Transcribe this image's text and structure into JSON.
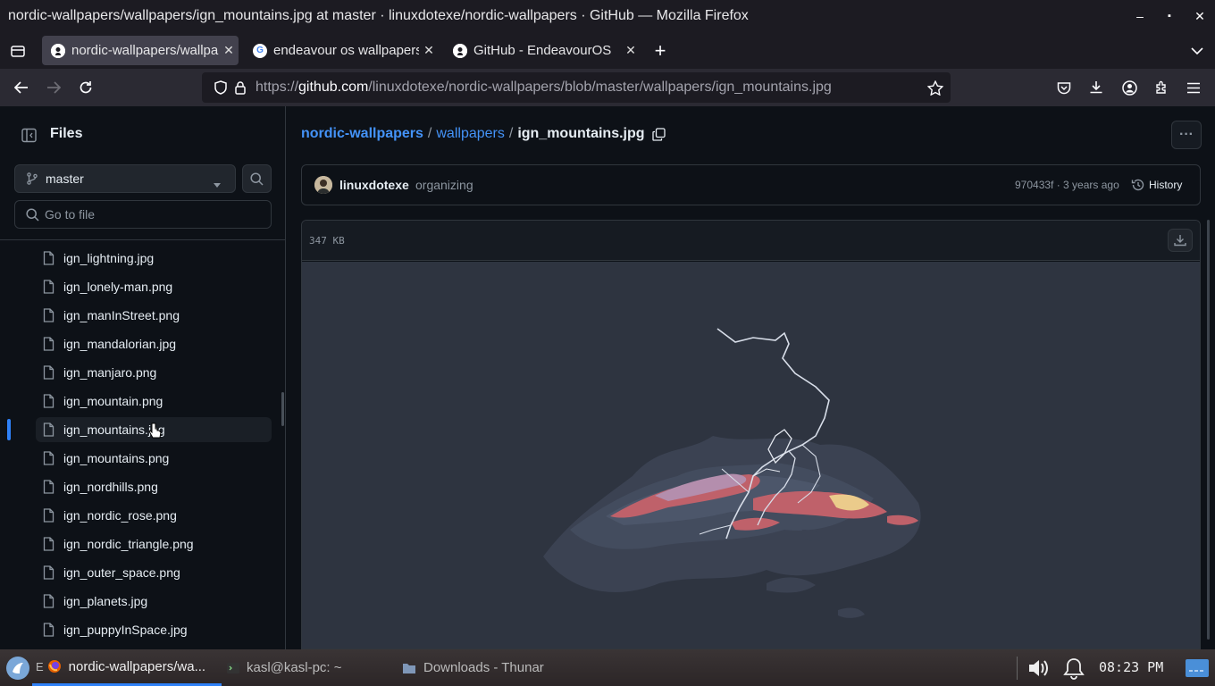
{
  "window": {
    "title": "nordic-wallpapers/wallpapers/ign_mountains.jpg at master · linuxdotexe/nordic-wallpapers · GitHub — Mozilla Firefox",
    "minimize_glyph": "–",
    "maximize_glyph": "▪",
    "close_glyph": "✕"
  },
  "tabs": [
    {
      "label": "nordic-wallpapers/wallpapers/ign_mountains.jpg",
      "icon": "github-icon",
      "active": true
    },
    {
      "label": "endeavour os wallpapers",
      "icon": "google-icon",
      "active": false
    },
    {
      "label": "GitHub - EndeavourOS",
      "icon": "github-icon",
      "active": false
    }
  ],
  "tab_close_glyph": "✕",
  "new_tab_glyph": "+",
  "url": {
    "prefix": "https://",
    "host": "github.com",
    "path": "/linuxdotexe/nordic-wallpapers/blob/master/wallpapers/ign_mountains.jpg"
  },
  "sidebar": {
    "title": "Files",
    "branch": "master",
    "goto_placeholder": "Go to file",
    "files": [
      "ign_lightning.jpg",
      "ign_lonely-man.png",
      "ign_manInStreet.png",
      "ign_mandalorian.jpg",
      "ign_manjaro.png",
      "ign_mountain.png",
      "ign_mountains.jpg",
      "ign_mountains.png",
      "ign_nordhills.png",
      "ign_nordic_rose.png",
      "ign_nordic_triangle.png",
      "ign_outer_space.png",
      "ign_planets.jpg",
      "ign_puppyInSpace.jpg"
    ],
    "selected_file": "ign_mountains.jpg"
  },
  "breadcrumb": {
    "repo": "nordic-wallpapers",
    "sep": "/",
    "folder": "wallpapers",
    "file": "ign_mountains.jpg"
  },
  "more_glyph": "···",
  "commit": {
    "author": "linuxdotexe",
    "message": "organizing",
    "meta": "970433f · 3 years ago",
    "history_label": "History"
  },
  "file": {
    "size": "347 KB"
  },
  "taskbar": {
    "items": [
      {
        "label": "nordic-wallpapers/wa...",
        "prefix": "E",
        "active": true
      },
      {
        "label": "kasl@kasl-pc: ~",
        "prefix": "",
        "active": false
      },
      {
        "label": "Downloads - Thunar",
        "prefix": "",
        "active": false
      }
    ],
    "clock": "08:23 PM"
  },
  "colors": {
    "link": "#4493f8",
    "accent": "#2f81f7",
    "nord_bg": "#2e3440"
  }
}
